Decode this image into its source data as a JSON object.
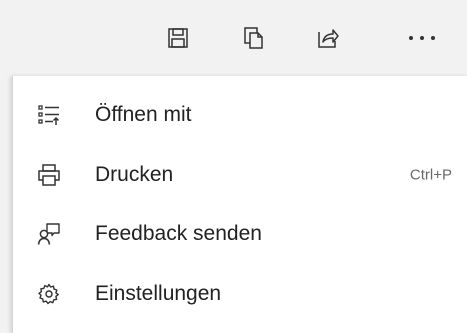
{
  "toolbar": {
    "buttons": [
      {
        "icon": "save-icon"
      },
      {
        "icon": "copy-icon"
      },
      {
        "icon": "share-icon"
      },
      {
        "icon": "more-icon",
        "label": "···"
      }
    ]
  },
  "menu": {
    "items": [
      {
        "icon": "open-with-icon",
        "label": "Öffnen mit",
        "shortcut": ""
      },
      {
        "icon": "print-icon",
        "label": "Drucken",
        "shortcut": "Ctrl+P"
      },
      {
        "icon": "feedback-icon",
        "label": "Feedback senden",
        "shortcut": ""
      },
      {
        "icon": "settings-icon",
        "label": "Einstellungen",
        "shortcut": ""
      }
    ]
  },
  "colors": {
    "toolbar_bg": "#f2f2f2",
    "menu_bg": "#ffffff",
    "text": "#222222",
    "shortcut_text": "#6a6a6a"
  }
}
